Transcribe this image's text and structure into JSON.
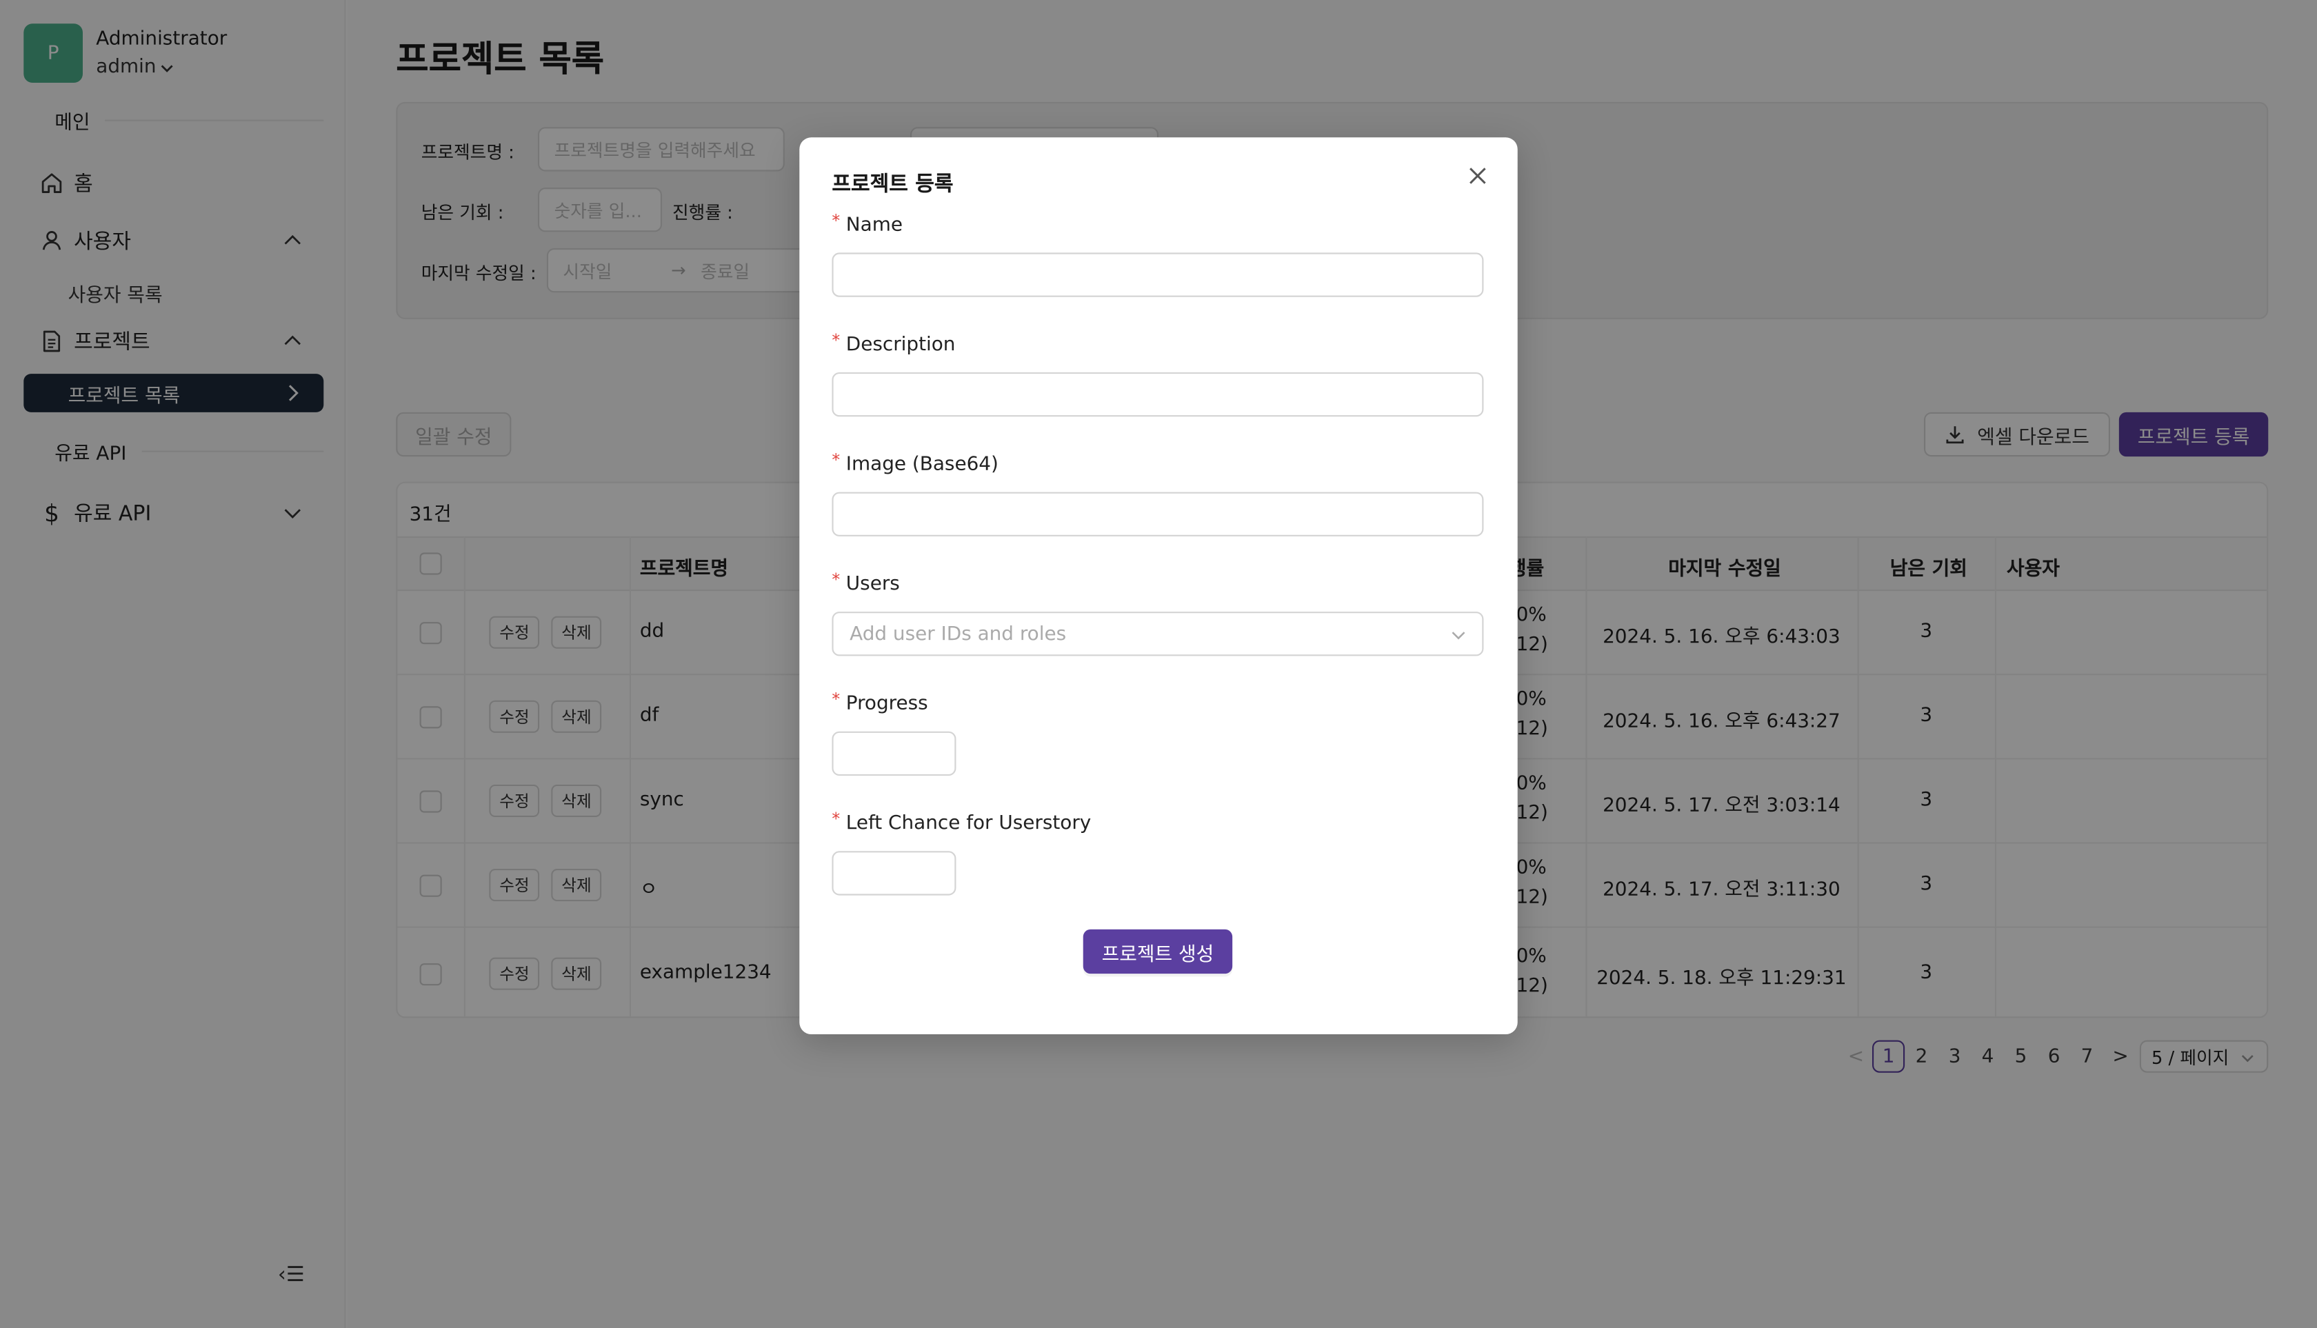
{
  "sidebar": {
    "avatar_letter": "P",
    "user_name": "Administrator",
    "user_role": "admin",
    "section_main": "메인",
    "home": "홈",
    "users": "사용자",
    "users_list": "사용자 목록",
    "projects": "프로젝트",
    "projects_list": "프로젝트 목록",
    "section_paid": "유료 API",
    "paid_api": "유료 API",
    "collapse_icon": "‹☰"
  },
  "page": {
    "title": "프로젝트 목록"
  },
  "filters": {
    "name_label": "프로젝트명 :",
    "name_placeholder": "프로젝트명을 입력해주세요",
    "chance_label": "남은 기회 :",
    "chance_placeholder": "숫자를 입...",
    "progress_label": "진행률 :",
    "modified_label": "마지막 수정일 :",
    "start_placeholder": "시작일",
    "arrow": "→",
    "end_placeholder": "종료일"
  },
  "actions": {
    "bulk_edit": "일괄 수정",
    "excel_download": "엑셀 다운로드",
    "register": "프로젝트 등록"
  },
  "table": {
    "count": "31건",
    "headers": {
      "name": "프로젝트명",
      "progress": "행률",
      "modified": "마지막 수정일",
      "chance": "남은 기회",
      "users": "사용자"
    },
    "edit_label": "수정",
    "delete_label": "삭제",
    "rows": [
      {
        "name": "dd",
        "progress_top": "0%",
        "progress_bottom": "12)",
        "modified": "2024. 5. 16. 오후 6:43:03",
        "chance": "3"
      },
      {
        "name": "df",
        "progress_top": "0%",
        "progress_bottom": "12)",
        "modified": "2024. 5. 16. 오후 6:43:27",
        "chance": "3"
      },
      {
        "name": "sync",
        "progress_top": "0%",
        "progress_bottom": "12)",
        "modified": "2024. 5. 17. 오전 3:03:14",
        "chance": "3"
      },
      {
        "name": "ㅇ",
        "progress_top": "0%",
        "progress_bottom": "12)",
        "modified": "2024. 5. 17. 오전 3:11:30",
        "chance": "3"
      },
      {
        "name": "example1234",
        "progress_top": "0%",
        "progress_bottom": "12)",
        "modified": "2024. 5. 18. 오후 11:29:31",
        "chance": "3"
      }
    ]
  },
  "pagination": {
    "prev": "<",
    "pages": [
      "1",
      "2",
      "3",
      "4",
      "5",
      "6",
      "7"
    ],
    "current": "1",
    "next": ">",
    "page_size": "5 / 페이지"
  },
  "modal": {
    "title": "프로젝트 등록",
    "required_mark": "*",
    "name_label": "Name",
    "description_label": "Description",
    "image_label": "Image (Base64)",
    "users_label": "Users",
    "users_placeholder": "Add user IDs and roles",
    "progress_label": "Progress",
    "chance_label": "Left Chance for Userstory",
    "submit": "프로젝트 생성"
  }
}
